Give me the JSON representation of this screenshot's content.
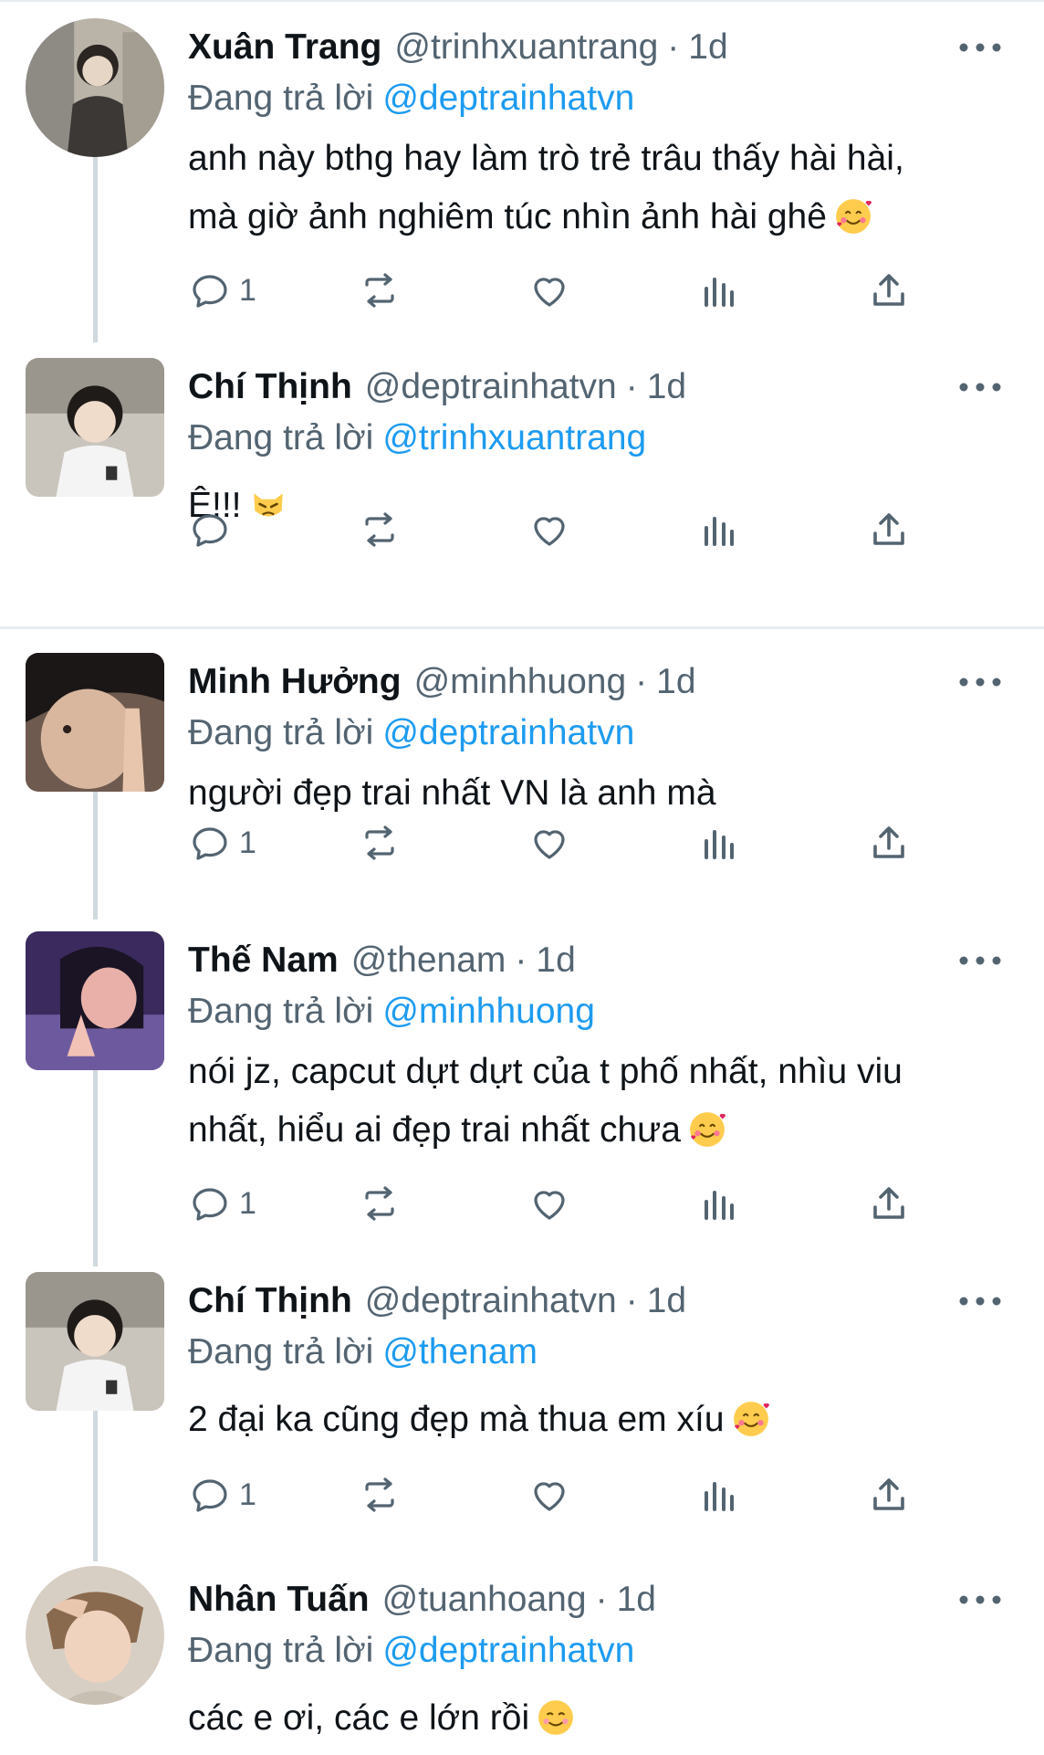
{
  "colors": {
    "link": "#1d9bf0",
    "secondary": "#536471",
    "text": "#0f1419",
    "divider": "#e6ecf0",
    "thread": "#cfd9de"
  },
  "reply_to_label": "Đang trả lời",
  "tweets": [
    {
      "name": "Xuân Trang",
      "handle": "@trinhxuantrang",
      "dot": "·",
      "time": "1d",
      "reply_to": "@deptrainhatvn",
      "text_lines": [
        "anh này bthg hay làm trò trẻ trâu thấy hài hài,",
        "mà giờ ảnh nghiêm túc nhìn ảnh hài ghê"
      ],
      "emoji": "smiling-face-with-hearts",
      "reply_count": "1"
    },
    {
      "name": "Chí Thịnh",
      "handle": "@deptrainhatvn",
      "dot": "·",
      "time": "1d",
      "reply_to": "@trinhxuantrang",
      "text_lines": [
        "Ê!!!"
      ],
      "emoji": "pouting-cat",
      "reply_count": ""
    },
    {
      "name": "Minh Hưởng",
      "handle": "@minhhuong",
      "dot": "·",
      "time": "1d",
      "reply_to": "@deptrainhatvn",
      "text_lines": [
        "người đẹp trai nhất VN là anh mà"
      ],
      "emoji": "",
      "reply_count": "1"
    },
    {
      "name": "Thế Nam",
      "handle": "@thenam",
      "dot": "·",
      "time": "1d",
      "reply_to": "@minhhuong",
      "text_lines": [
        "nói jz, capcut dựt dựt của t phố nhất, nhìu viu",
        "nhất, hiểu ai đẹp trai nhất chưa"
      ],
      "emoji": "smiling-face-with-hearts",
      "reply_count": "1"
    },
    {
      "name": "Chí Thịnh",
      "handle": "@deptrainhatvn",
      "dot": "·",
      "time": "1d",
      "reply_to": "@thenam",
      "text_lines": [
        "2 đại ka cũng đẹp mà thua em xíu"
      ],
      "emoji": "smiling-face-with-hearts",
      "reply_count": "1"
    },
    {
      "name": "Nhân Tuấn",
      "handle": "@tuanhoang",
      "dot": "·",
      "time": "1d",
      "reply_to": "@deptrainhatvn",
      "text_lines": [
        "các e ơi, các e lớn rồi"
      ],
      "emoji": "smiling-face",
      "reply_count": ""
    }
  ]
}
